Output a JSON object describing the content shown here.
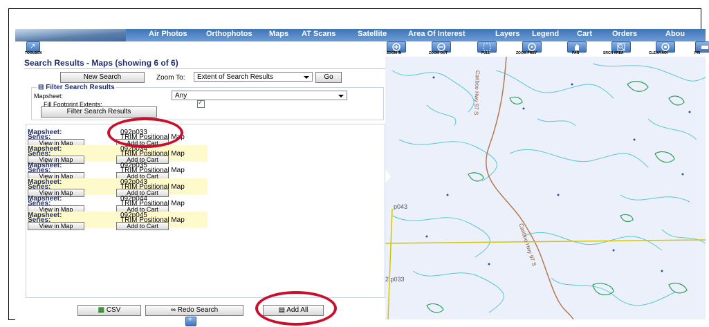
{
  "nav": {
    "items": [
      "Air Photos",
      "Orthophotos",
      "Maps",
      "AT Scans",
      "Satellite",
      "Area Of Interest",
      "Layers",
      "Legend",
      "Cart",
      "Orders",
      "Abou"
    ]
  },
  "toolbar": {
    "toolbox_label": "TOOLBOX",
    "buttons": [
      "ZOOM IN",
      "ZOOM OUT",
      "FULL",
      "ZOOM PREV",
      "PAN",
      "SRCH AREA",
      "CLEAR AOI",
      "PRI"
    ]
  },
  "panel": {
    "title": "Search Results - Maps (showing 6 of 6)",
    "new_search": "New Search",
    "zoom_to_label": "Zoom To:",
    "zoom_to_value": "Extent of Search Results",
    "go": "Go",
    "filter_toggle": "⊟",
    "filter_title": "Filter Search Results",
    "mapsheet_label": "Mapsheet:",
    "mapsheet_value": "Any",
    "fill_label": "Fill Footprint Extents:",
    "fill_checked": "✓",
    "filter_button": "Filter Search Results"
  },
  "results": [
    {
      "mapsheet_label": "Mapsheet:",
      "mapsheet": "092p033",
      "series_label": "Series:",
      "series": "TRIM Positional Map",
      "view": "View in Map",
      "add": "Add to Cart"
    },
    {
      "mapsheet_label": "Mapsheet:",
      "mapsheet": "092p034",
      "series_label": "Series:",
      "series": "TRIM Positional Map",
      "view": "View in Map",
      "add": "Add to Cart"
    },
    {
      "mapsheet_label": "Mapsheet:",
      "mapsheet": "092p035",
      "series_label": "Series:",
      "series": "TRIM Positional Map",
      "view": "View in Map",
      "add": "Add to Cart"
    },
    {
      "mapsheet_label": "Mapsheet:",
      "mapsheet": "092p043",
      "series_label": "Series:",
      "series": "TRIM Positional Map",
      "view": "View in Map",
      "add": "Add to Cart"
    },
    {
      "mapsheet_label": "Mapsheet:",
      "mapsheet": "092p044",
      "series_label": "Series:",
      "series": "TRIM Positional Map",
      "view": "View in Map",
      "add": "Add to Cart"
    },
    {
      "mapsheet_label": "Mapsheet:",
      "mapsheet": "092p045",
      "series_label": "Series:",
      "series": "TRIM Positional Map",
      "view": "View in Map",
      "add": "Add to Cart"
    }
  ],
  "bottom": {
    "csv": "CSV",
    "redo": "Redo Search",
    "add_all": "Add All"
  },
  "map": {
    "road_label_1": "Cariboo Hwy 97 S",
    "road_label_2": "Cariboo Hwy 97 S",
    "sheet_label_1": "p043",
    "sheet_label_2": "2 p033"
  },
  "colors": {
    "nav_bg": "#4a7fc1",
    "panel_title": "#1f2f6e",
    "row_highlight": "#fffacc",
    "annotation_red": "#c8102e",
    "map_bg": "#ecf0fb",
    "contour": "#56c7d6",
    "forest": "#2e9e5a",
    "sheet_line": "#d6c500"
  },
  "icons": [
    "toolbox-icon",
    "zoom-in-icon",
    "zoom-out-icon",
    "full-extent-icon",
    "zoom-prev-icon",
    "pan-icon",
    "search-area-icon",
    "clear-aoi-icon",
    "print-icon",
    "spreadsheet-icon",
    "binoculars-icon",
    "cart-icon"
  ]
}
